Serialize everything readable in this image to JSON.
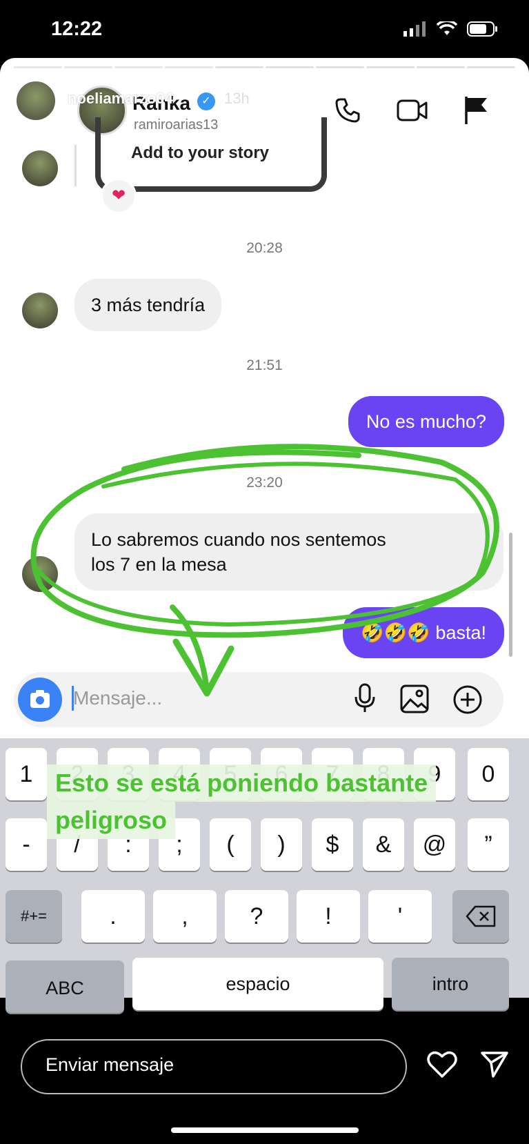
{
  "status_bar": {
    "time": "12:22"
  },
  "story": {
    "username": "noeliamarzo04",
    "posted": "13h",
    "more": "•••"
  },
  "chat_header": {
    "name": "Ranka",
    "handle": "ramiroarias13"
  },
  "story_preview": {
    "text": "Add to your story"
  },
  "messages": [
    {
      "type": "timestamp",
      "text": "20:28"
    },
    {
      "type": "incoming",
      "text": "3 más tendría"
    },
    {
      "type": "timestamp",
      "text": "21:51"
    },
    {
      "type": "outgoing",
      "text": "No es mucho?"
    },
    {
      "type": "timestamp",
      "text": "23:20"
    },
    {
      "type": "incoming",
      "text": "Lo sabremos cuando nos sentemos\nlos 7 en la mesa"
    },
    {
      "type": "outgoing",
      "text": "🤣🤣🤣 basta!"
    }
  ],
  "composer": {
    "placeholder": "Mensaje..."
  },
  "keyboard": {
    "row1": [
      "1",
      "2",
      "3",
      "4",
      "5",
      "6",
      "7",
      "8",
      "9",
      "0"
    ],
    "row2": [
      "-",
      "/",
      ":",
      ";",
      "(",
      ")",
      "$",
      "&",
      "@",
      "”"
    ],
    "row3": [
      ".",
      ",",
      "?",
      "!",
      "'"
    ],
    "mode_key": "#+=",
    "abc": "ABC",
    "space": "espacio",
    "return": "intro"
  },
  "overlay": {
    "caption_line1": "Esto se está poniendo bastante",
    "caption_line2": "peligroso"
  },
  "footer": {
    "reply_placeholder": "Enviar mensaje"
  },
  "colors": {
    "outgoing": "#6a44f2",
    "annotation": "#4cc233",
    "camera": "#3b82f6"
  }
}
